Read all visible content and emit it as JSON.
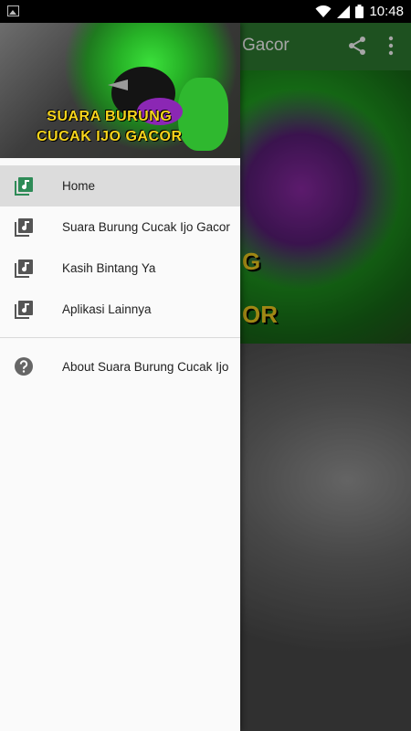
{
  "status_bar": {
    "time": "10:48"
  },
  "app": {
    "toolbar_title": "Gacor",
    "hero_text_line1": "G",
    "hero_text_line2": "OR"
  },
  "drawer": {
    "header": {
      "line1": "SUARA BURUNG",
      "line2": "CUCAK IJO GACOR"
    },
    "items": [
      {
        "label": "Home",
        "icon": "music-library-icon",
        "selected": true
      },
      {
        "label": "Suara Burung Cucak Ijo Gacor",
        "icon": "music-library-icon"
      },
      {
        "label": "Kasih Bintang Ya",
        "icon": "music-library-icon"
      },
      {
        "label": "Aplikasi Lainnya",
        "icon": "music-library-icon"
      }
    ],
    "about": {
      "label": "About Suara Burung Cucak Ijo",
      "icon": "help-icon"
    }
  },
  "colors": {
    "primary": "#2e7d32",
    "accent_icon": "#2e8b57",
    "header_text": "#f7d51c"
  }
}
